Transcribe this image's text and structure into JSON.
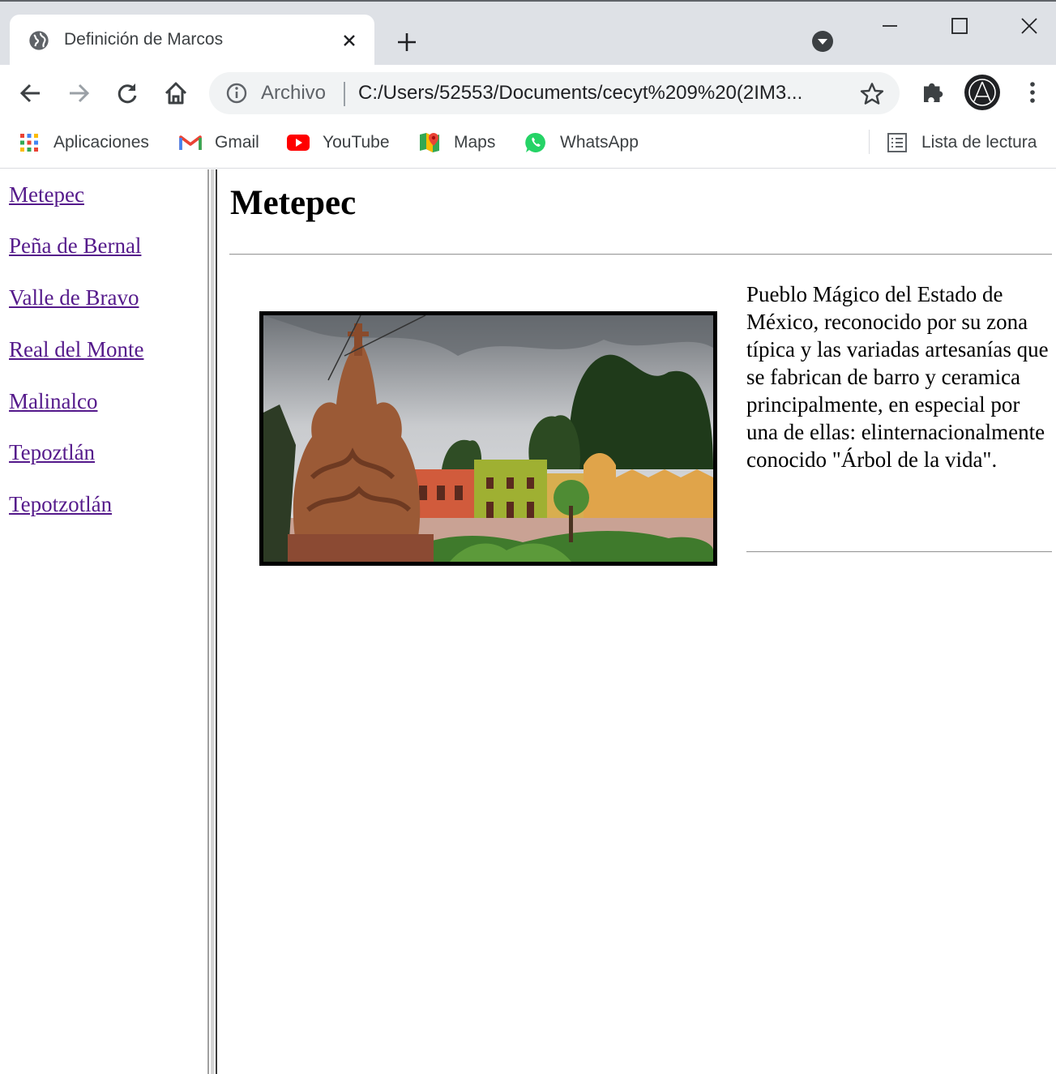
{
  "browser": {
    "tab": {
      "title": "Definición de Marcos"
    },
    "omnibox": {
      "scheme_label": "Archivo",
      "url": "C:/Users/52553/Documents/cecyt%209%20(2IM3..."
    },
    "bookmarks": [
      {
        "label": "Aplicaciones",
        "icon": "apps-grid-icon"
      },
      {
        "label": "Gmail",
        "icon": "gmail-icon"
      },
      {
        "label": "YouTube",
        "icon": "youtube-icon"
      },
      {
        "label": "Maps",
        "icon": "maps-icon"
      },
      {
        "label": "WhatsApp",
        "icon": "whatsapp-icon"
      }
    ],
    "reading_list": "Lista de lectura"
  },
  "nav": {
    "links": [
      "Metepec",
      "Peña de Bernal",
      "Valle de Bravo",
      "Real del Monte",
      "Malinalco",
      "Tepoztlán",
      "Tepotzotlán"
    ]
  },
  "main": {
    "title": "Metepec",
    "description": "Pueblo Mágico del Estado de México, reconocido por su zona típica y las variadas artesanías que se fabrican de barro y ceramica principalmente, en especial por una de ellas: elinternacionalmente conocido \"Árbol de la vida\"."
  },
  "colors": {
    "link_visited": "#551a8b",
    "tabstrip_bg": "#dee1e6",
    "omnibox_bg": "#f1f3f4"
  }
}
